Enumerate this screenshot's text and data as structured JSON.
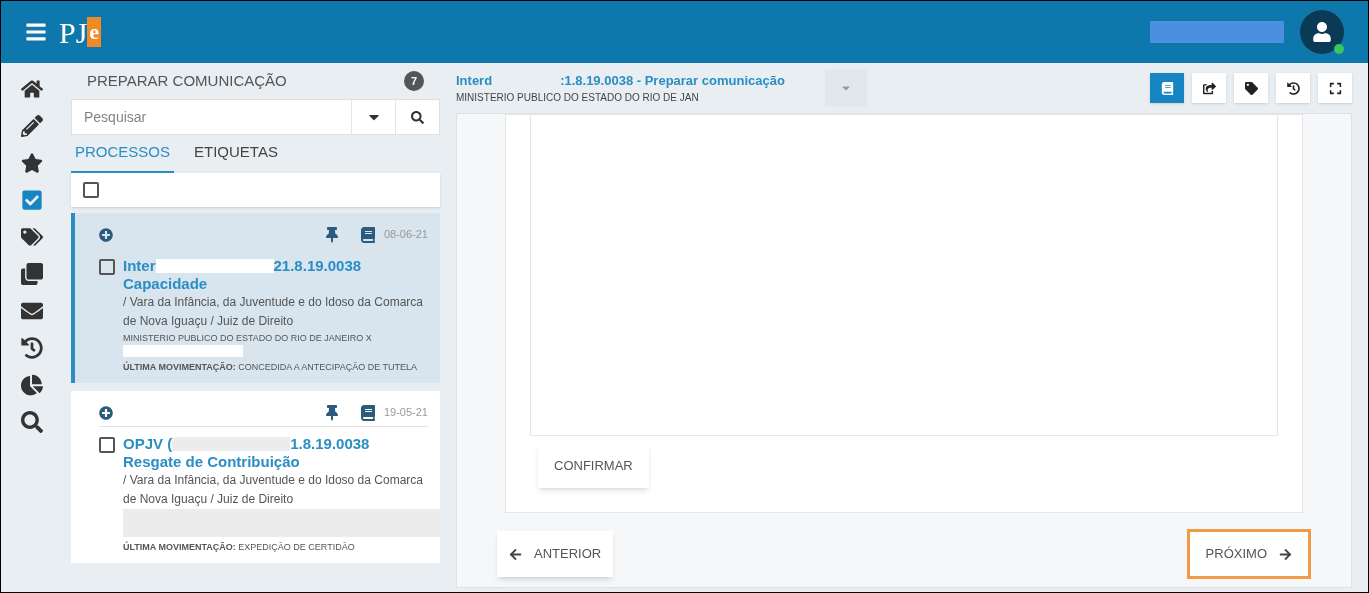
{
  "header": {
    "logo_main": "PJ",
    "logo_accent": "e"
  },
  "nav": [
    {
      "kind": "home",
      "selected": false
    },
    {
      "kind": "pencil",
      "selected": false
    },
    {
      "kind": "star",
      "selected": false
    },
    {
      "kind": "tasks",
      "selected": true
    },
    {
      "kind": "tags",
      "selected": false
    },
    {
      "kind": "clone",
      "selected": false
    },
    {
      "kind": "mail",
      "selected": false
    },
    {
      "kind": "history",
      "selected": false
    },
    {
      "kind": "chart",
      "selected": false
    },
    {
      "kind": "search",
      "selected": false
    }
  ],
  "panel": {
    "title": "PREPARAR COMUNICAÇÃO",
    "count": "7",
    "search": {
      "placeholder": "Pesquisar"
    },
    "tabs": [
      {
        "label": "PROCESSOS",
        "selected": true
      },
      {
        "label": "ETIQUETAS",
        "selected": false
      }
    ],
    "select_all_checked": false,
    "cards": [
      {
        "selected": true,
        "checked": false,
        "date": "08-06-21",
        "title_start": "Inter",
        "title_end": "21.8.19.0038",
        "subject": "Capacidade",
        "court": "/ Vara da Infância, da Juventude e do Idoso da Comarca de Nova Iguaçu / Juiz de Direito",
        "parties": "MINISTERIO PUBLICO DO ESTADO DO RIO DE JANEIRO X",
        "last_move_label": "ÚLTIMA MOVIMENTAÇÃO:",
        "last_move_value": "CONCEDIDA A ANTECIPAÇÃO DE TUTELA"
      },
      {
        "selected": false,
        "checked": false,
        "date": "19-05-21",
        "title_start": "OPJV (",
        "title_end": "1.8.19.0038",
        "subject": "Resgate de Contribuição",
        "court": "/ Vara da Infância, da Juventude e do Idoso da Comarca de Nova Iguaçu / Juiz de Direito",
        "last_move_label": "ÚLTIMA MOVIMENTAÇÃO:",
        "last_move_value": "EXPEDIÇÃO DE CERTIDÃO"
      }
    ]
  },
  "main": {
    "title_start": "Interd",
    "title_end": ":1.8.19.0038 - Preparar comunicação",
    "subtitle": "MINISTERIO PUBLICO DO ESTADO DO RIO DE JAN",
    "toolbar": [
      {
        "kind": "book",
        "selected": true
      },
      {
        "kind": "share",
        "selected": false
      },
      {
        "kind": "tag",
        "selected": false
      },
      {
        "kind": "history",
        "selected": false
      },
      {
        "kind": "expand",
        "selected": false
      }
    ],
    "confirm": "CONFIRMAR",
    "previous": "ANTERIOR",
    "next": {
      "label": "PRÓXIMO",
      "highlighted": true
    }
  }
}
